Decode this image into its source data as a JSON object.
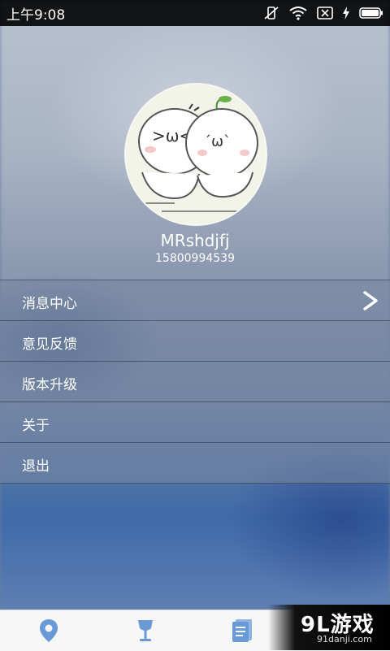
{
  "status_bar": {
    "time": "上午9:08"
  },
  "profile": {
    "username": "MRshdjfj",
    "phone": "15800994539"
  },
  "menu": {
    "items": [
      {
        "label": "消息中心"
      },
      {
        "label": "意见反馈"
      },
      {
        "label": "版本升级"
      },
      {
        "label": "关于"
      },
      {
        "label": "退出"
      }
    ]
  },
  "tabs": [
    {
      "icon": "location-pin-icon"
    },
    {
      "icon": "wine-glass-icon"
    },
    {
      "icon": "document-icon"
    }
  ],
  "colors": {
    "tab_icon": "#6a9ad6",
    "menu_bg": "#7e8aa4"
  },
  "watermark": {
    "logo": "9L游戏",
    "sub": "91danji.com"
  }
}
